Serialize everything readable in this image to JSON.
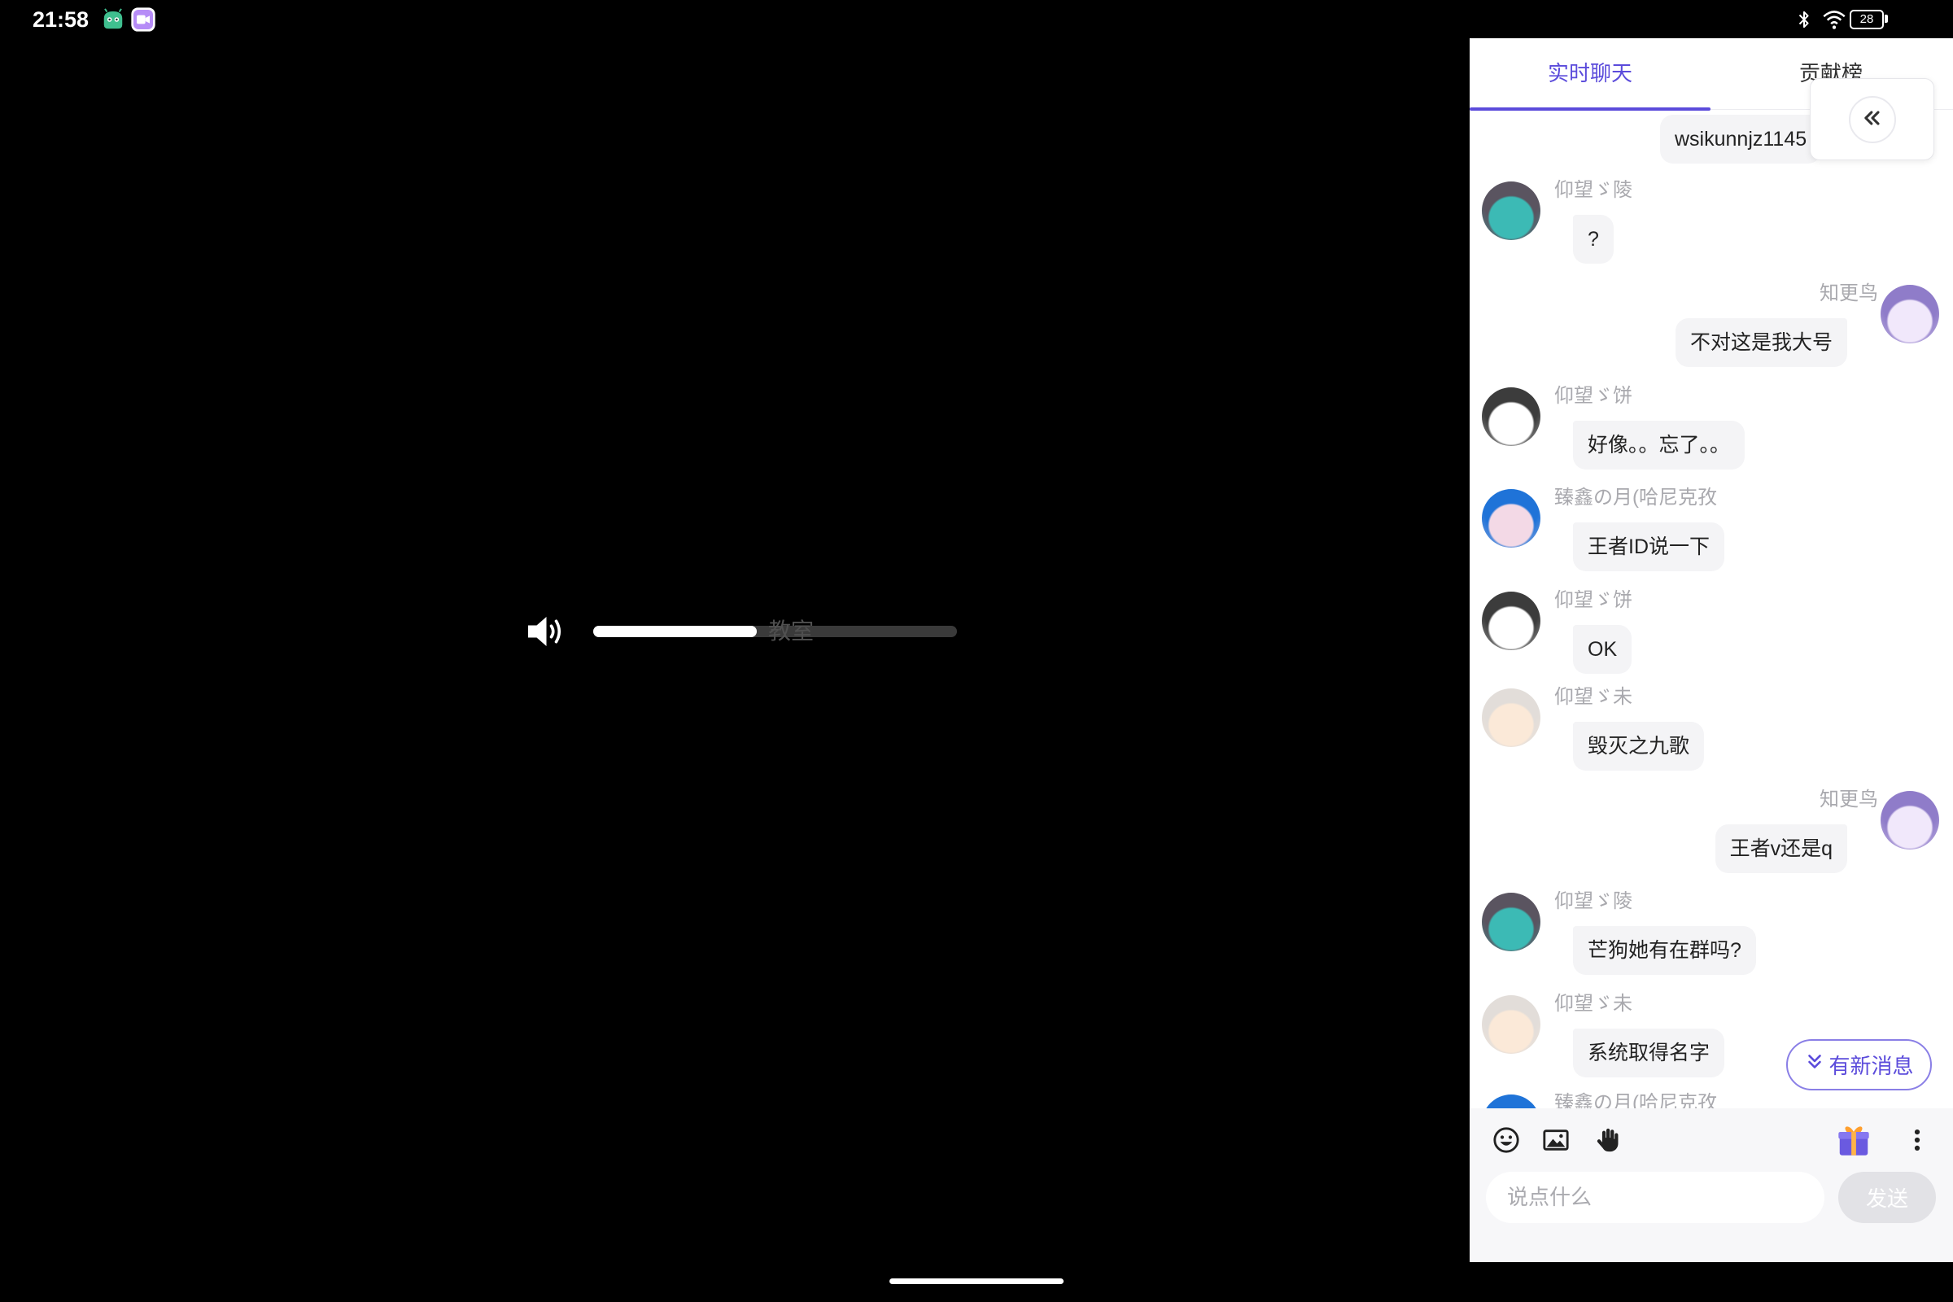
{
  "status_bar": {
    "time": "21:58",
    "battery": "28",
    "left_icons": [
      "robot-app-icon",
      "video-app-icon"
    ],
    "right_icons": [
      "bluetooth-icon",
      "wifi-icon",
      "battery-icon"
    ]
  },
  "player": {
    "background_text": "教室",
    "volume_icon": "volume-icon",
    "volume_level": 0.45
  },
  "chat": {
    "tabs": [
      {
        "label": "实时聊天",
        "active": true
      },
      {
        "label": "贡献榜",
        "active": false
      }
    ],
    "collapse_icon": "double-chevron-left-icon",
    "messages": [
      {
        "outgoing": true,
        "text": "wsikunnjz1145"
      },
      {
        "outgoing": false,
        "sender": "仰望ゞ陵",
        "text": "?",
        "avatar_colors": [
          "#3cbab5",
          "#5a5460"
        ]
      },
      {
        "outgoing": true,
        "sender": "知更鸟",
        "text": "不对这是我大号",
        "avatar_colors": [
          "#f1e8fb",
          "#8f7cc9"
        ]
      },
      {
        "outgoing": false,
        "sender": "仰望ゞ饼",
        "text": "好像。。忘了。。",
        "avatar_colors": [
          "#ffffff",
          "#3c3c3c"
        ]
      },
      {
        "outgoing": false,
        "sender": "臻鑫の月(哈尼克孜",
        "text": "王者ID说一下",
        "avatar_colors": [
          "#f3d9e6",
          "#1f73d8"
        ]
      },
      {
        "outgoing": false,
        "sender": "仰望ゞ饼",
        "text": "OK",
        "avatar_colors": [
          "#ffffff",
          "#3c3c3c"
        ]
      },
      {
        "outgoing": false,
        "sender": "仰望ゞ未",
        "text": "毁灭之九歌",
        "avatar_colors": [
          "#fbe9d8",
          "#e2ddd9"
        ]
      },
      {
        "outgoing": true,
        "sender": "知更鸟",
        "text": "王者v还是q",
        "avatar_colors": [
          "#f1e8fb",
          "#8f7cc9"
        ]
      },
      {
        "outgoing": false,
        "sender": "仰望ゞ陵",
        "text": "芒狗她有在群吗?",
        "avatar_colors": [
          "#3cbab5",
          "#5a5460"
        ]
      },
      {
        "outgoing": false,
        "sender": "仰望ゞ未",
        "text": "系统取得名字",
        "avatar_colors": [
          "#fbe9d8",
          "#e2ddd9"
        ]
      },
      {
        "outgoing": false,
        "sender": "臻鑫の月(哈尼克孜",
        "avatar_colors": [
          "#f3d9e6",
          "#1f73d8"
        ]
      }
    ],
    "new_messages_label": "有新消息",
    "new_messages_icon": "double-chevron-down-icon",
    "toolbar_icons": [
      "emoji-icon",
      "image-icon",
      "raise-hand-icon",
      "gift-icon",
      "more-vertical-icon"
    ],
    "input": {
      "placeholder": "说点什么"
    },
    "send_label": "发送"
  },
  "colors": {
    "accent": "#5b4bdb",
    "bubble": "#f4f4f6",
    "sender_name": "#a9a9ae",
    "send_disabled": "#e2e2e6"
  }
}
